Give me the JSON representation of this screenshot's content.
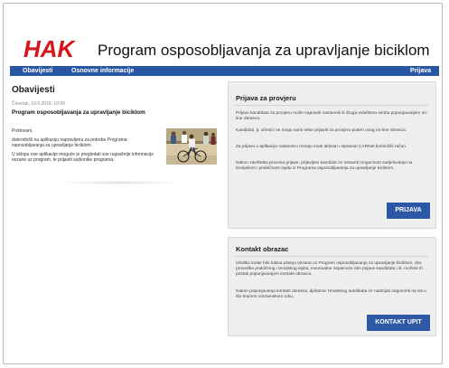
{
  "header": {
    "logo_text": "HAK",
    "title": "Program osposobljavanja za upravljanje biciklom"
  },
  "nav": {
    "items": [
      "Obavijesti",
      "Osnovne informacije"
    ],
    "right_item": "Prijava"
  },
  "news": {
    "section_title": "Obavijesti",
    "date": "Četvrtak, 10.6.2016. 10:00",
    "title": "Program osposobljavanja za upravljanje biciklom",
    "greeting": "Poštovani,",
    "paragraphs": [
      "dobrodošli na aplikaciju napravljenu za potrebe Programa osposobljavanja za upravljanje biciklom.",
      "U sklopu ove aplikacije moguće je pregledati sve najvažnije informacije vezane uz program, te prijaviti sudionike programa."
    ]
  },
  "prijava_panel": {
    "title": "Prijava za provjeru",
    "paragraphs": [
      "Prijavu kandidata za provjeru može napraviti nastavnik ili druga ovlaštena osoba popunjavanjem on-line obrasca.",
      "Kandidati, tj. učenici ne mogu sami sebe prijaviti za provjeru putem ovog on-line obrasca.",
      "Za prijavu u aplikaciju nastavnici moraju imati aktivan i ispravan CARNet korisnički račun.",
      "Nakon završetka procesa prijave, prijavljeni kandidat će ostvariti mogućnost sudjelovanja na teorijskom i praktičnom ispitu iz Programa osposobljavanja za upravljanje biciklom."
    ],
    "button_label": "PRIJAVA"
  },
  "kontakt_panel": {
    "title": "Kontakt obrazac",
    "paragraphs": [
      "Ukoliko imate bilo kakva pitanja vezana uz Program osposobljavanja za upravljanje biciklom, oko provedbe praktičnog i teorijskog ispita, eventualne nejasnoće oko prijave kandidata i sl. možete ih postati popunjavanjem kontakt obrasca.",
      "Nakon popunjavanja kontakt obrasca, djelatnici Hrvatskog autokluba će nastojati odgovoriti na isti u što kraćem vremenskom roku."
    ],
    "button_label": "KONTAKT UPIT"
  },
  "colors": {
    "brand_blue": "#2a57a4",
    "logo_red": "#d5151b",
    "button_blue": "#2d58a6",
    "panel_bg": "#eeeeee"
  }
}
